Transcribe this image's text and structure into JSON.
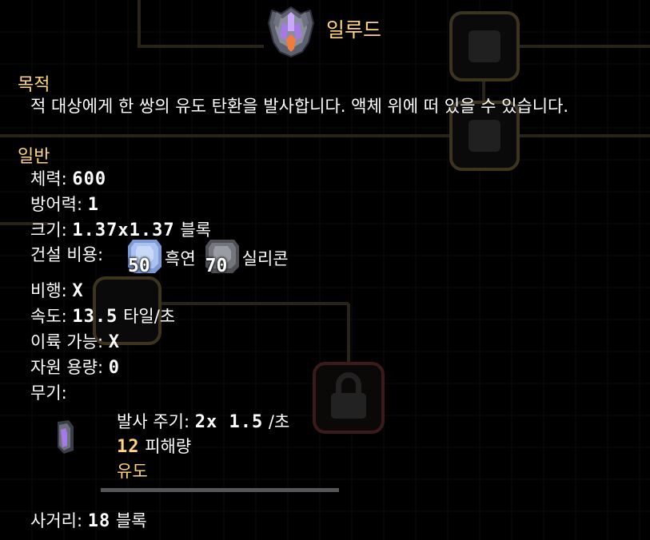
{
  "unit": {
    "name": "일루드",
    "icon": "illude-unit-icon"
  },
  "sections": {
    "purpose_header": "목적",
    "purpose_text": "적 대상에게 한 쌍의 유도 탄환을 발사합니다. 액체 위에 떠 있을 수 있습니다.",
    "general_header": "일반"
  },
  "stats": {
    "health_label": "체력:",
    "health_value": "600",
    "armor_label": "방어력:",
    "armor_value": "1",
    "size_label": "크기:",
    "size_value": "1.37x1.37",
    "size_unit": "블록",
    "cost_label": "건설 비용:",
    "flying_label": "비행:",
    "flying_value": "X",
    "speed_label": "속도:",
    "speed_value": "13.5",
    "speed_unit": "타일/초",
    "canboost_label": "이륙 가능:",
    "canboost_value": "X",
    "capacity_label": "자원 용량:",
    "capacity_value": "0",
    "weapons_label": "무기:",
    "range_label": "사거리:",
    "range_value": "18",
    "range_unit": "블록"
  },
  "cost": [
    {
      "amount": "50",
      "name": "흑연",
      "icon": "graphite-icon"
    },
    {
      "amount": "70",
      "name": "실리콘",
      "icon": "silicon-icon"
    }
  ],
  "weapon": {
    "icon": "missile-weapon-icon",
    "reload_label": "발사 주기:",
    "reload_value": "2x 1.5",
    "reload_unit": "/초",
    "damage_value": "12",
    "damage_label": "피해량",
    "homing": "유도"
  },
  "colors": {
    "background": "#000000",
    "accent": "#ffd37f",
    "text": "#ffffff",
    "divider": "#55555a"
  }
}
